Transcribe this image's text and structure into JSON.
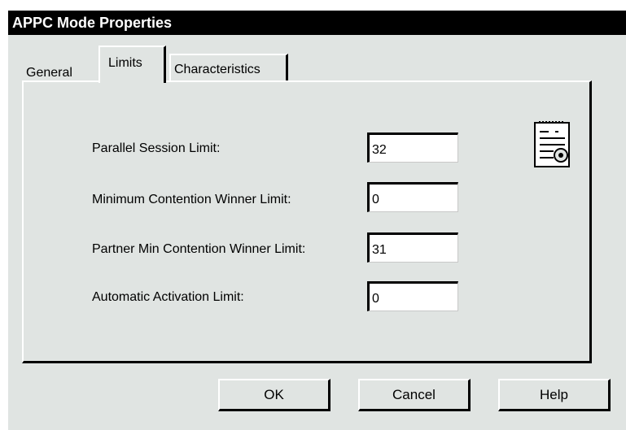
{
  "window": {
    "title": "APPC Mode Properties"
  },
  "tabs": {
    "general": "General",
    "limits": "Limits",
    "characteristics": "Characteristics"
  },
  "fields": {
    "parallel_session_limit": {
      "label": "Parallel Session Limit:",
      "value": "32"
    },
    "min_contention_winner_limit": {
      "label": "Minimum Contention Winner Limit:",
      "value": "0"
    },
    "partner_min_contention_winner_limit": {
      "label": "Partner Min Contention Winner Limit:",
      "value": "31"
    },
    "automatic_activation_limit": {
      "label": "Automatic Activation Limit:",
      "value": "0"
    }
  },
  "buttons": {
    "ok": "OK",
    "cancel": "Cancel",
    "help": "Help"
  },
  "icons": {
    "properties": "properties-document-icon"
  }
}
